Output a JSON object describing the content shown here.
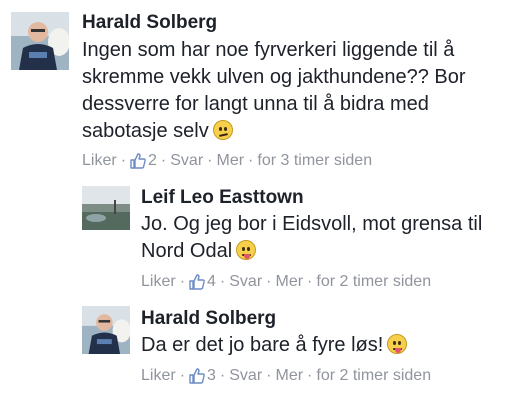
{
  "comments": [
    {
      "author": "Harald Solberg",
      "lines": [
        "Ingen som har noe fyrverkeri liggende til å",
        "skremme vekk ulven og jakthundene?? Bor",
        "dessverre for langt unna til å bidra med",
        "sabotasje selv"
      ],
      "emoji": "confused-face-emoji",
      "like_label": "Liker",
      "like_count": "2",
      "reply_label": "Svar",
      "more_label": "Mer",
      "time": "for 3 timer siden"
    },
    {
      "author": "Leif Leo Easttown",
      "lines": [
        "Jo. Og jeg bor i Eidsvoll, mot grensa til",
        "Nord Odal"
      ],
      "emoji": "tongue-face-emoji",
      "like_label": "Liker",
      "like_count": "4",
      "reply_label": "Svar",
      "more_label": "Mer",
      "time": "for 2 timer siden"
    },
    {
      "author": "Harald Solberg",
      "lines": [
        "Da er det jo bare å fyre løs!"
      ],
      "emoji": "tongue-face-emoji",
      "like_label": "Liker",
      "like_count": "3",
      "reply_label": "Svar",
      "more_label": "Mer",
      "time": "for 2 timer siden"
    }
  ],
  "separator": "·",
  "colors": {
    "text": "#1d2129",
    "meta": "#90949c",
    "like_icon": "#90949c"
  },
  "icons": {
    "like": "thumbs-up-icon"
  }
}
